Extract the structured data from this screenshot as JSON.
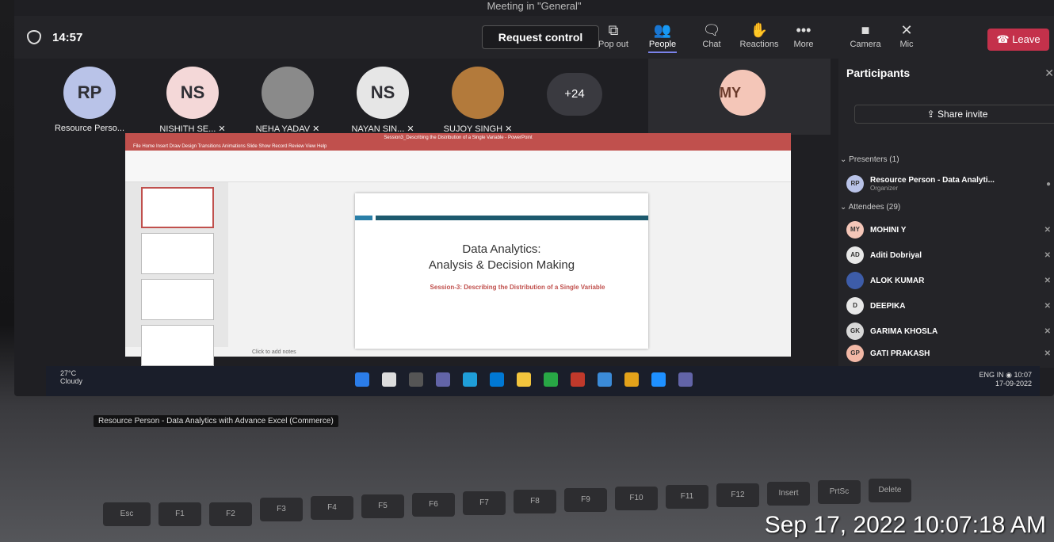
{
  "window": {
    "title": "Meeting in \"General\""
  },
  "topbar": {
    "time": "14:57",
    "request_control": "Request control",
    "tools": [
      {
        "label": "Pop out",
        "icon": "popout-icon"
      },
      {
        "label": "People",
        "icon": "people-icon"
      },
      {
        "label": "Chat",
        "icon": "chat-icon"
      },
      {
        "label": "Reactions",
        "icon": "reactions-icon"
      },
      {
        "label": "More",
        "icon": "more-icon"
      },
      {
        "label": "Camera",
        "icon": "camera-off-icon"
      },
      {
        "label": "Mic",
        "icon": "mic-off-icon"
      }
    ],
    "leave": "Leave"
  },
  "tiles": [
    {
      "initials": "RP",
      "name": "Resource Perso...",
      "color": "#b9c3e8"
    },
    {
      "initials": "NS",
      "name": "NISHITH SE...",
      "color": "#f4d8d8"
    },
    {
      "initials": "",
      "name": "NEHA YADAV",
      "color": "#8a8a8a"
    },
    {
      "initials": "NS",
      "name": "NAYAN SIN...",
      "color": "#e6e6e6"
    },
    {
      "initials": "",
      "name": "SUJOY SINGH",
      "color": "#b37a3b"
    }
  ],
  "more_count": "+24",
  "self_initials": "MY",
  "ppt": {
    "title": "Session3_Describing the Distribution of a Single Variable - PowerPoint",
    "menu": "File   Home   Insert   Draw   Design   Transitions   Animations   Slide Show   Record   Review   View   Help",
    "slide_title1": "Data Analytics:",
    "slide_title2": "Analysis & Decision Making",
    "slide_sub": "Session-3: Describing the Distribution of a Single Variable",
    "notes": "Click to add notes"
  },
  "caption": "Resource Person - Data Analytics with Advance Excel (Commerce)",
  "panel": {
    "title": "Participants",
    "share": "Share invite",
    "presenters_header": "Presenters (1)",
    "attendees_header": "Attendees (29)",
    "presenter": {
      "initials": "RP",
      "name": "Resource Person - Data Analyti...",
      "role": "Organizer"
    },
    "attendees": [
      {
        "initials": "MY",
        "name": "MOHINI Y",
        "color": "#f4c6b8"
      },
      {
        "initials": "AD",
        "name": "Aditi Dobriyal",
        "color": "#e8e8e8"
      },
      {
        "initials": "",
        "name": "ALOK KUMAR",
        "color": "#3d5ca8"
      },
      {
        "initials": "D",
        "name": "DEEPIKA",
        "color": "#e8e8e8"
      },
      {
        "initials": "GK",
        "name": "GARIMA KHOSLA",
        "color": "#d8d8d8"
      },
      {
        "initials": "GP",
        "name": "GATI PRAKASH",
        "color": "#f2b8a6"
      }
    ]
  },
  "taskbar": {
    "temp": "27°C",
    "weather": "Cloudy",
    "lang": "ENG",
    "region": "IN",
    "time": "10:07",
    "date": "17-09-2022"
  },
  "keyboard": {
    "keys": [
      "Esc",
      "F1",
      "F2",
      "F3",
      "F4",
      "F5",
      "F6",
      "F7",
      "F8",
      "F9",
      "F10",
      "F11",
      "F12",
      "Insert",
      "PrtSc",
      "Delete"
    ]
  },
  "stamp": "Sep 17, 2022 10:07:18 AM"
}
